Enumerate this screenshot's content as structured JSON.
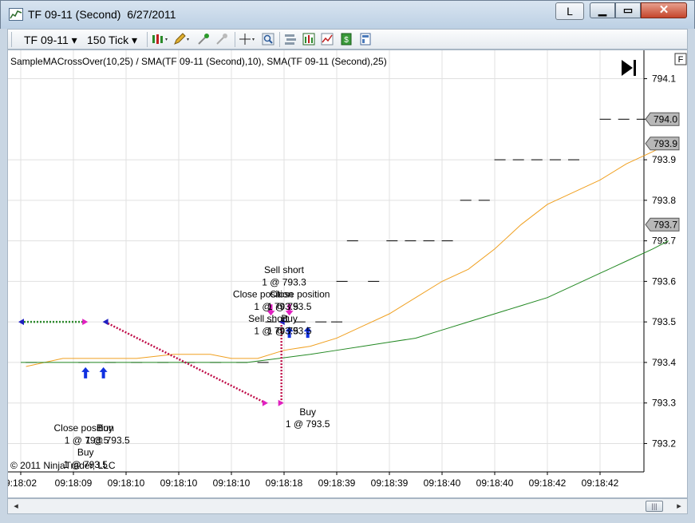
{
  "window": {
    "title": "TF 09-11 (Second)  6/27/2011",
    "l_button": "L",
    "minimize_icon": "minimize-icon",
    "maximize_icon": "maximize-icon",
    "close_icon": "close-icon"
  },
  "toolbar": {
    "instrument": "TF 09-11",
    "interval": "150 Tick",
    "icons": [
      "bar-type-icon",
      "drawing-pencil-icon",
      "zoom-in-icon",
      "zoom-out-icon",
      "crosshair-icon",
      "magnifier-icon",
      "properties-icon",
      "strategies-icon",
      "indicators-icon",
      "money-icon",
      "template-icon"
    ]
  },
  "chart_data": {
    "type": "line",
    "header_label": "SampleMACrossOver(10,25)  /  SMA(TF  09-11 (Second),10),  SMA(TF  09-11 (Second),25)",
    "copyright": "© 2011 NinjaTrader, LLC",
    "panel_toggle_label": "F",
    "x_ticks": [
      "9:18:02",
      "09:18:09",
      "09:18:10",
      "09:18:10",
      "09:18:10",
      "09:18:18",
      "09:18:39",
      "09:18:39",
      "09:18:40",
      "09:18:40",
      "09:18:42",
      "09:18:42"
    ],
    "y_ticks": [
      794.1,
      793.9,
      793.8,
      793.7,
      793.6,
      793.5,
      793.4,
      793.3,
      793.2
    ],
    "y_tick_labels": [
      "794.1",
      "793.9",
      "793.8",
      "793.7",
      "793.6",
      "793.5",
      "793.4",
      "793.3",
      "793.2"
    ],
    "ylim": [
      793.13,
      794.17
    ],
    "price_markers": [
      {
        "label": "794.0",
        "value": 794.0
      },
      {
        "label": "793.9",
        "value": 793.94
      },
      {
        "label": "793.7",
        "value": 793.74
      }
    ],
    "grid": true,
    "price_bars": {
      "color": "#000000",
      "style": "flat dashes",
      "points": [
        {
          "x": 0.2,
          "y": 793.4
        },
        {
          "x": 1.2,
          "y": 793.4
        },
        {
          "x": 1.7,
          "y": 793.4
        },
        {
          "x": 2.2,
          "y": 793.4
        },
        {
          "x": 2.7,
          "y": 793.4
        },
        {
          "x": 3.2,
          "y": 793.4
        },
        {
          "x": 3.7,
          "y": 793.4
        },
        {
          "x": 4.2,
          "y": 793.4
        },
        {
          "x": 4.6,
          "y": 793.4
        },
        {
          "x": 4.75,
          "y": 793.5
        },
        {
          "x": 5.0,
          "y": 793.5
        },
        {
          "x": 5.3,
          "y": 793.5
        },
        {
          "x": 5.7,
          "y": 793.5
        },
        {
          "x": 6.0,
          "y": 793.5
        },
        {
          "x": 6.1,
          "y": 793.6
        },
        {
          "x": 6.7,
          "y": 793.6
        },
        {
          "x": 6.3,
          "y": 793.7
        },
        {
          "x": 7.05,
          "y": 793.7
        },
        {
          "x": 7.4,
          "y": 793.7
        },
        {
          "x": 7.75,
          "y": 793.7
        },
        {
          "x": 8.1,
          "y": 793.7
        },
        {
          "x": 8.45,
          "y": 793.8
        },
        {
          "x": 8.8,
          "y": 793.8
        },
        {
          "x": 9.1,
          "y": 793.9
        },
        {
          "x": 9.45,
          "y": 793.9
        },
        {
          "x": 9.8,
          "y": 793.9
        },
        {
          "x": 10.15,
          "y": 793.9
        },
        {
          "x": 10.5,
          "y": 793.9
        },
        {
          "x": 11.1,
          "y": 794.0
        },
        {
          "x": 11.45,
          "y": 794.0
        },
        {
          "x": 11.8,
          "y": 794.0
        },
        {
          "x": 12.15,
          "y": 794.0
        }
      ]
    },
    "series": [
      {
        "name": "SMA(TF  09-11 (Second),10)",
        "color": "#f0a020",
        "points": [
          [
            0.1,
            793.39
          ],
          [
            0.8,
            793.41
          ],
          [
            1.5,
            793.41
          ],
          [
            2.2,
            793.41
          ],
          [
            2.9,
            793.42
          ],
          [
            3.6,
            793.42
          ],
          [
            4.0,
            793.41
          ],
          [
            4.5,
            793.41
          ],
          [
            5.0,
            793.43
          ],
          [
            5.5,
            793.44
          ],
          [
            6.0,
            793.46
          ],
          [
            6.5,
            793.49
          ],
          [
            7.0,
            793.52
          ],
          [
            7.5,
            793.56
          ],
          [
            8.0,
            793.6
          ],
          [
            8.5,
            793.63
          ],
          [
            9.0,
            793.68
          ],
          [
            9.5,
            793.74
          ],
          [
            10.0,
            793.79
          ],
          [
            10.5,
            793.82
          ],
          [
            11.0,
            793.85
          ],
          [
            11.5,
            793.89
          ],
          [
            12.0,
            793.92
          ],
          [
            12.3,
            793.94
          ]
        ]
      },
      {
        "name": "SMA(TF  09-11 (Second),25)",
        "color": "#228822",
        "points": [
          [
            0.0,
            793.4
          ],
          [
            0.8,
            793.4
          ],
          [
            1.5,
            793.4
          ],
          [
            2.2,
            793.4
          ],
          [
            2.9,
            793.4
          ],
          [
            3.6,
            793.4
          ],
          [
            4.3,
            793.4
          ],
          [
            4.9,
            793.41
          ],
          [
            5.5,
            793.42
          ],
          [
            6.0,
            793.43
          ],
          [
            6.5,
            793.44
          ],
          [
            7.0,
            793.45
          ],
          [
            7.5,
            793.46
          ],
          [
            8.0,
            793.48
          ],
          [
            8.5,
            793.5
          ],
          [
            9.0,
            793.52
          ],
          [
            9.5,
            793.54
          ],
          [
            10.0,
            793.56
          ],
          [
            10.5,
            793.59
          ],
          [
            11.0,
            793.62
          ],
          [
            11.5,
            793.65
          ],
          [
            12.0,
            793.68
          ],
          [
            12.3,
            793.7
          ]
        ]
      }
    ],
    "trade_markers": [
      {
        "kind": "buy",
        "x": 1.23,
        "y": 793.4,
        "labels": [
          "Close position",
          "1 @ 793.5",
          "Buy",
          "1 @ 793.5"
        ]
      },
      {
        "kind": "buy",
        "x": 1.57,
        "y": 793.4,
        "labels": [
          "Buy",
          "1 @ 793.5"
        ]
      },
      {
        "kind": "sell",
        "x": 4.75,
        "y": 793.5,
        "labels": [
          "Sell short",
          "1 @ 793.5"
        ]
      },
      {
        "kind": "sell",
        "x": 5.1,
        "y": 793.5,
        "labels": [
          "Close position",
          "1 @ 793.5",
          "Sell short",
          "1 @ 793.3"
        ]
      },
      {
        "kind": "buy",
        "x": 5.1,
        "y": 793.5,
        "labels": [
          "Buy",
          "1 @ 793.5"
        ]
      },
      {
        "kind": "buy",
        "x": 5.45,
        "y": 793.5,
        "labels": [
          "Buy",
          "1 @ 793.5"
        ]
      }
    ],
    "trade_texts": [
      {
        "text": "Sell short",
        "x": 5.0,
        "y": 793.62
      },
      {
        "text": "1 @ 793.3",
        "x": 5.0,
        "y": 793.59
      },
      {
        "text": "Close position",
        "x": 4.6,
        "y": 793.56
      },
      {
        "text": "Close position",
        "x": 5.3,
        "y": 793.56
      },
      {
        "text": "1 @ 793.5",
        "x": 4.85,
        "y": 793.53
      },
      {
        "text": "1 @ 793.5",
        "x": 5.1,
        "y": 793.53
      },
      {
        "text": "Sell short",
        "x": 4.7,
        "y": 793.5
      },
      {
        "text": "Buy",
        "x": 5.1,
        "y": 793.5
      },
      {
        "text": "1 @ 793.5",
        "x": 4.85,
        "y": 793.47
      },
      {
        "text": "1 @ 793.5",
        "x": 5.1,
        "y": 793.47
      },
      {
        "text": "Buy",
        "x": 5.45,
        "y": 793.27
      },
      {
        "text": "1 @ 793.5",
        "x": 5.45,
        "y": 793.24
      },
      {
        "text": "Close position",
        "x": 1.2,
        "y": 793.23
      },
      {
        "text": "Buy",
        "x": 1.6,
        "y": 793.23
      },
      {
        "text": "1 @ 793.5",
        "x": 1.25,
        "y": 793.2
      },
      {
        "text": "1 @ 793.5",
        "x": 1.65,
        "y": 793.2
      },
      {
        "text": "Buy",
        "x": 1.23,
        "y": 793.17
      },
      {
        "text": "1 @ 793.5",
        "x": 1.23,
        "y": 793.14
      }
    ],
    "trade_lines": [
      {
        "color": "#2d8a2d",
        "from": [
          0.0,
          793.5
        ],
        "to": [
          1.23,
          793.5
        ]
      },
      {
        "color": "#c0104a",
        "from": [
          1.6,
          793.5
        ],
        "to": [
          4.65,
          793.3
        ]
      },
      {
        "color": "#c0104a",
        "from": [
          4.95,
          793.5
        ],
        "to": [
          4.95,
          793.3
        ]
      }
    ],
    "x_positions_note": ""
  },
  "scrollbar": {
    "left_arrow": "◂",
    "right_arrow": "▸",
    "thumb_grip": "|||"
  }
}
